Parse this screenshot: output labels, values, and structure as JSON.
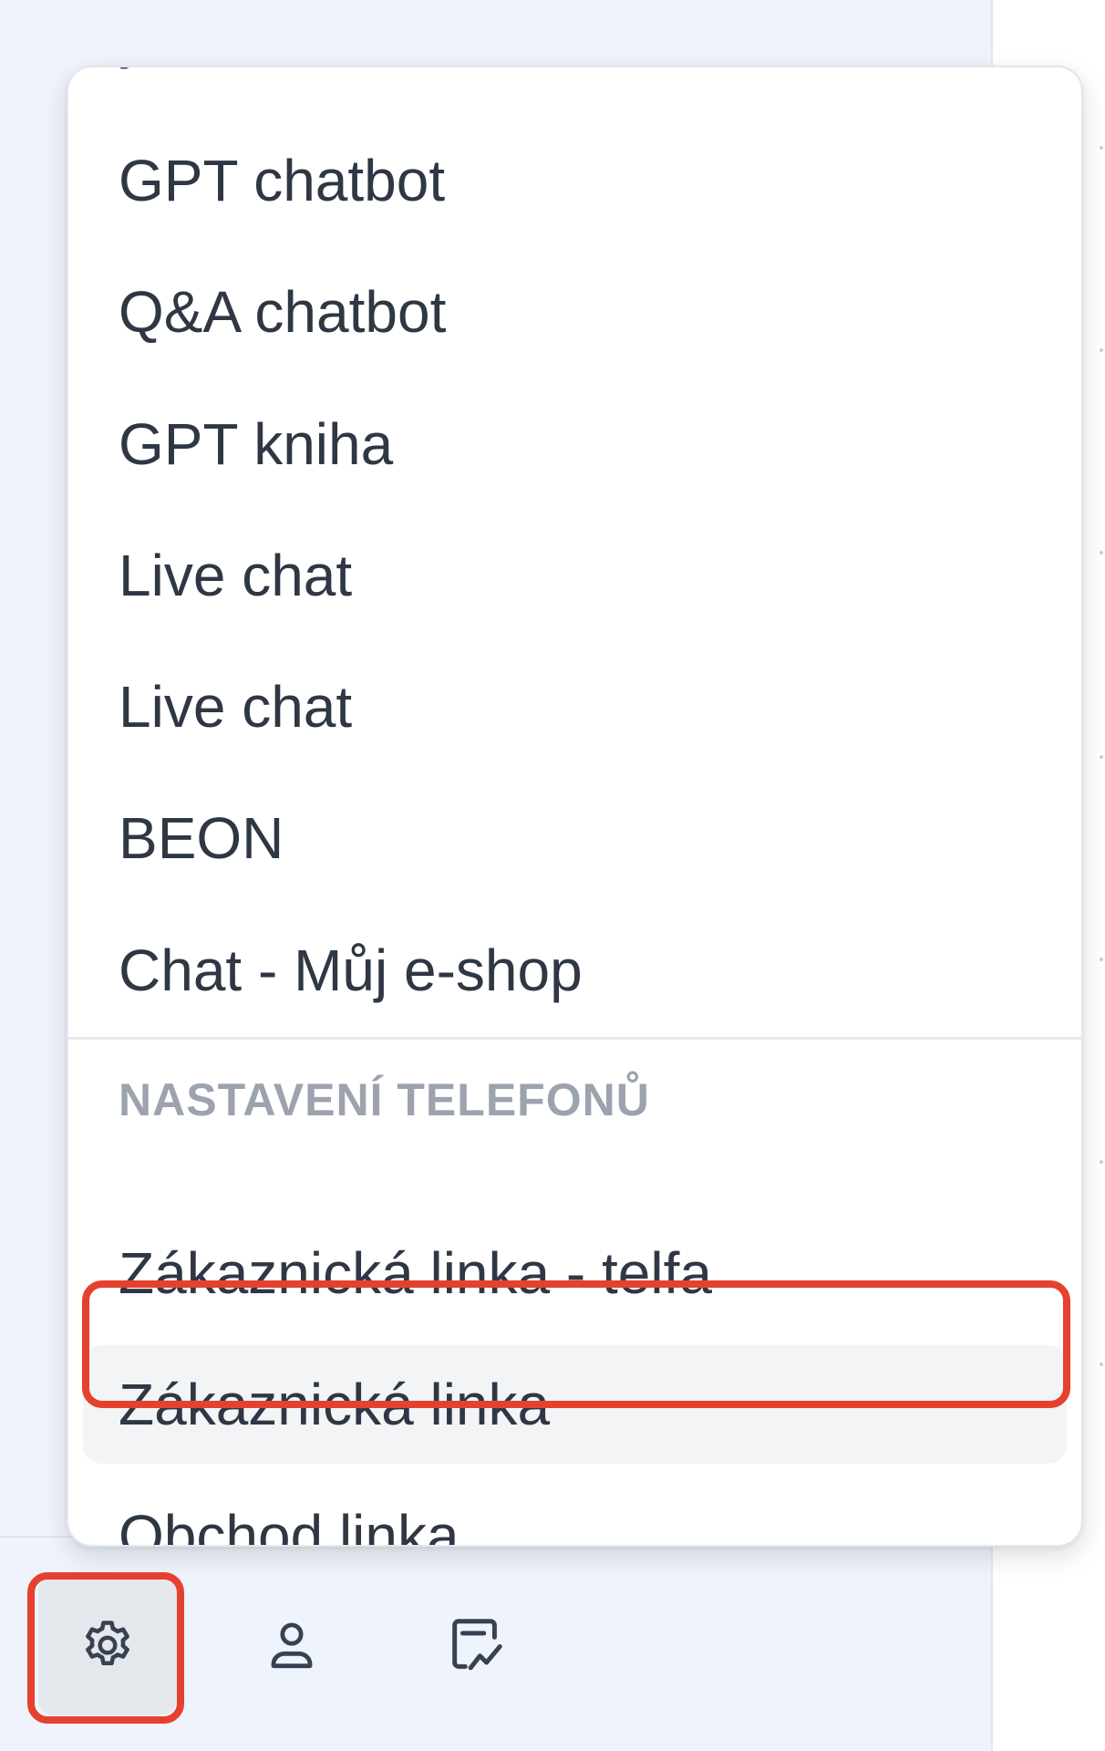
{
  "menu": {
    "clipped_item_label": "y",
    "items": [
      {
        "label": "GPT chatbot"
      },
      {
        "label": "Q&A chatbot"
      },
      {
        "label": "GPT kniha"
      },
      {
        "label": "Live chat"
      },
      {
        "label": "Live chat"
      },
      {
        "label": "BEON"
      },
      {
        "label": "Chat - Můj e-shop"
      }
    ],
    "phone_group": {
      "header": "NASTAVENÍ TELEFONŮ",
      "items": [
        {
          "label": "Zákaznická linka - telfa"
        },
        {
          "label": "Zákaznická linka",
          "highlighted": true
        },
        {
          "label": "Obchod linka"
        }
      ]
    }
  },
  "bottom_bar": {
    "buttons": [
      {
        "icon": "gear-icon",
        "active": true
      },
      {
        "icon": "user-icon",
        "active": false
      },
      {
        "icon": "signature-chart-icon",
        "active": false
      }
    ]
  },
  "annotation_color": "#e5412e"
}
